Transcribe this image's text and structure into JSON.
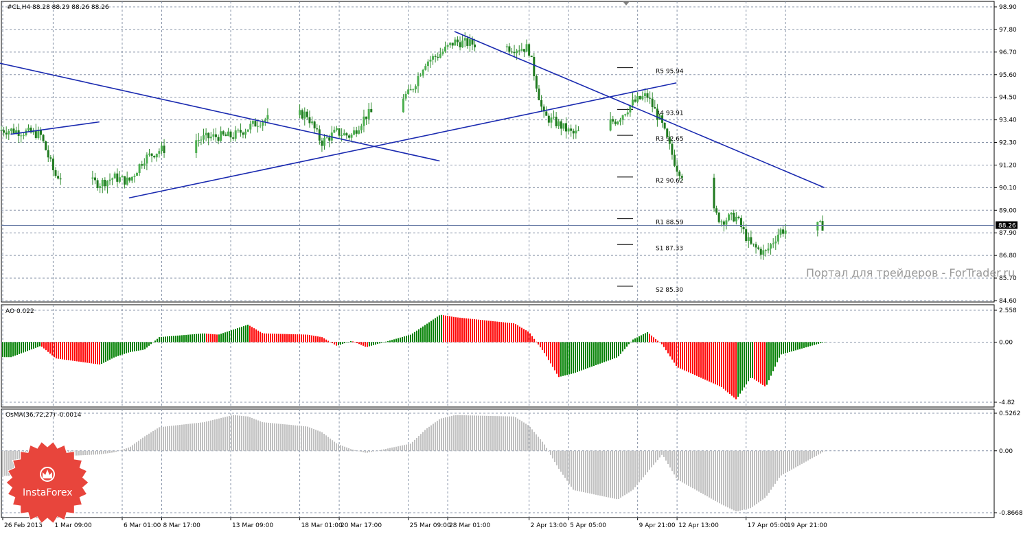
{
  "chart_data": [
    {
      "type": "candlestick",
      "title": "#CL,H4 88.28 88.29 88.26 88.26",
      "symbol": "#CL",
      "timeframe": "H4",
      "ohlc": {
        "open": 88.28,
        "high": 88.29,
        "low": 88.26,
        "close": 88.26
      },
      "ylim": [
        84.6,
        98.9
      ],
      "y_ticks": [
        "98.90",
        "97.80",
        "96.70",
        "95.60",
        "94.50",
        "93.40",
        "92.30",
        "91.20",
        "90.10",
        "89.00",
        "87.90",
        "86.80",
        "85.70",
        "84.60"
      ],
      "current_price_label": "88.26",
      "current_price": 88.26,
      "candle_colors": {
        "up": "#4caf50",
        "down": "#1f7a1f",
        "wick": "#2e8b2e"
      },
      "close_series": [
        {
          "date": "2013-02-26",
          "close": 92.9
        },
        {
          "date": "2013-02-28",
          "close": 92.7
        },
        {
          "date": "2013-03-01",
          "close": 90.7
        },
        {
          "date": "2013-03-04",
          "close": 90.3
        },
        {
          "date": "2013-03-05",
          "close": 90.6
        },
        {
          "date": "2013-03-06",
          "close": 90.4
        },
        {
          "date": "2013-03-07",
          "close": 91.5
        },
        {
          "date": "2013-03-08",
          "close": 91.9
        },
        {
          "date": "2013-03-11",
          "close": 92.5
        },
        {
          "date": "2013-03-12",
          "close": 92.6
        },
        {
          "date": "2013-03-13",
          "close": 92.6
        },
        {
          "date": "2013-03-14",
          "close": 93.0
        },
        {
          "date": "2013-03-15",
          "close": 93.4
        },
        {
          "date": "2013-03-18",
          "close": 93.7
        },
        {
          "date": "2013-03-19",
          "close": 92.3
        },
        {
          "date": "2013-03-20",
          "close": 92.8
        },
        {
          "date": "2013-03-21",
          "close": 92.6
        },
        {
          "date": "2013-03-22",
          "close": 93.6
        },
        {
          "date": "2013-03-25",
          "close": 94.7
        },
        {
          "date": "2013-03-26",
          "close": 96.2
        },
        {
          "date": "2013-03-27",
          "close": 96.6
        },
        {
          "date": "2013-03-28",
          "close": 97.2
        },
        {
          "date": "2013-04-01",
          "close": 96.9
        },
        {
          "date": "2013-04-02",
          "close": 96.9
        },
        {
          "date": "2013-04-03",
          "close": 93.6
        },
        {
          "date": "2013-04-04",
          "close": 93.2
        },
        {
          "date": "2013-04-05",
          "close": 92.7
        },
        {
          "date": "2013-04-08",
          "close": 93.4
        },
        {
          "date": "2013-04-09",
          "close": 94.2
        },
        {
          "date": "2013-04-10",
          "close": 94.6
        },
        {
          "date": "2013-04-11",
          "close": 93.2
        },
        {
          "date": "2013-04-12",
          "close": 91.1
        },
        {
          "date": "2013-04-15",
          "close": 88.5
        },
        {
          "date": "2013-04-16",
          "close": 88.7
        },
        {
          "date": "2013-04-17",
          "close": 87.3
        },
        {
          "date": "2013-04-18",
          "close": 86.9
        },
        {
          "date": "2013-04-19",
          "close": 88.0
        },
        {
          "date": "2013-04-22",
          "close": 88.26
        }
      ],
      "trend_lines": [
        {
          "from": {
            "date": "2013-02-25",
            "price": 96.2
          },
          "to": {
            "date": "2013-03-27",
            "price": 91.4
          }
        },
        {
          "from": {
            "date": "2013-02-26",
            "price": 92.7
          },
          "to": {
            "date": "2013-03-04",
            "price": 93.3
          }
        },
        {
          "from": {
            "date": "2013-03-06",
            "price": 89.6
          },
          "to": {
            "date": "2013-04-12",
            "price": 95.2
          }
        },
        {
          "from": {
            "date": "2013-03-28",
            "price": 97.7
          },
          "to": {
            "date": "2013-04-22",
            "price": 90.1
          }
        }
      ],
      "pivot_levels": [
        {
          "name": "R5",
          "value": 95.94,
          "label": "R5 95.94"
        },
        {
          "name": "R4",
          "value": 93.91,
          "label": "R4 93.91"
        },
        {
          "name": "R3",
          "value": 92.65,
          "label": "R3 92.65"
        },
        {
          "name": "R2",
          "value": 90.62,
          "label": "R2 90.62"
        },
        {
          "name": "R1",
          "value": 88.59,
          "label": "R1 88.59"
        },
        {
          "name": "S1",
          "value": 87.33,
          "label": "S1 87.33"
        },
        {
          "name": "S2",
          "value": 85.3,
          "label": "S2 85.30"
        }
      ],
      "x_ticks": [
        "26 Feb 2013",
        "1 Mar 09:00",
        "6 Mar 01:00",
        "8 Mar 17:00",
        "13 Mar 09:00",
        "18 Mar 01:00",
        "20 Mar 17:00",
        "25 Mar 09:00",
        "28 Mar 01:00",
        "2 Apr 13:00",
        "5 Apr 05:00",
        "9 Apr 21:00",
        "12 Apr 13:00",
        "17 Apr 05:00",
        "19 Apr 21:00"
      ],
      "watermark": "Портал для трейдеров - ForTrader.ru",
      "grid": true
    },
    {
      "type": "bar",
      "title": "AO 0.022",
      "indicator": "Awesome Oscillator",
      "ylim": [
        -4.82,
        2.558
      ],
      "y_ticks": [
        "2.558",
        "0.00",
        "-4.82"
      ],
      "colors": {
        "rising": "#008000",
        "falling": "#ff0000"
      },
      "x": [
        "2013-02-26",
        "2013-02-28",
        "2013-03-01",
        "2013-03-04",
        "2013-03-05",
        "2013-03-06",
        "2013-03-07",
        "2013-03-08",
        "2013-03-11",
        "2013-03-12",
        "2013-03-13",
        "2013-03-14",
        "2013-03-15",
        "2013-03-18",
        "2013-03-19",
        "2013-03-20",
        "2013-03-21",
        "2013-03-22",
        "2013-03-25",
        "2013-03-26",
        "2013-03-27",
        "2013-03-28",
        "2013-04-01",
        "2013-04-02",
        "2013-04-03",
        "2013-04-04",
        "2013-04-05",
        "2013-04-08",
        "2013-04-09",
        "2013-04-10",
        "2013-04-11",
        "2013-04-12",
        "2013-04-15",
        "2013-04-16",
        "2013-04-17",
        "2013-04-18",
        "2013-04-19",
        "2013-04-22"
      ],
      "values": [
        -1.2,
        -0.3,
        -1.3,
        -1.8,
        -1.2,
        -0.8,
        -0.6,
        0.4,
        0.7,
        0.6,
        1.0,
        1.4,
        0.7,
        0.6,
        0.4,
        -0.3,
        0.1,
        -0.4,
        0.6,
        1.4,
        2.2,
        2.0,
        1.5,
        0.8,
        -0.8,
        -2.8,
        -2.5,
        -1.2,
        0.2,
        0.8,
        -0.2,
        -2.0,
        -3.6,
        -4.6,
        -2.8,
        -3.6,
        -1.0,
        0.02
      ]
    },
    {
      "type": "bar",
      "title": "OsMA(36,72,27) -0.0014",
      "indicator": "OsMA",
      "ylim": [
        -0.8668,
        0.5262
      ],
      "y_ticks": [
        "0.5262",
        "0.00",
        "-0.8668"
      ],
      "colors": {
        "bars": "#c0c0c0"
      },
      "x": [
        "2013-02-26",
        "2013-02-28",
        "2013-03-01",
        "2013-03-04",
        "2013-03-05",
        "2013-03-06",
        "2013-03-07",
        "2013-03-08",
        "2013-03-11",
        "2013-03-12",
        "2013-03-13",
        "2013-03-14",
        "2013-03-15",
        "2013-03-18",
        "2013-03-19",
        "2013-03-20",
        "2013-03-21",
        "2013-03-22",
        "2013-03-25",
        "2013-03-26",
        "2013-03-27",
        "2013-03-28",
        "2013-04-01",
        "2013-04-02",
        "2013-04-03",
        "2013-04-04",
        "2013-04-05",
        "2013-04-08",
        "2013-04-09",
        "2013-04-10",
        "2013-04-11",
        "2013-04-12",
        "2013-04-15",
        "2013-04-16",
        "2013-04-17",
        "2013-04-18",
        "2013-04-19",
        "2013-04-22"
      ],
      "values": [
        -0.35,
        -0.2,
        -0.08,
        -0.05,
        -0.02,
        0.05,
        0.2,
        0.33,
        0.4,
        0.45,
        0.5,
        0.48,
        0.4,
        0.34,
        0.26,
        0.1,
        0.02,
        -0.03,
        0.1,
        0.3,
        0.45,
        0.5,
        0.48,
        0.35,
        0.1,
        -0.25,
        -0.55,
        -0.68,
        -0.55,
        -0.3,
        -0.05,
        -0.4,
        -0.75,
        -0.85,
        -0.8,
        -0.65,
        -0.35,
        -0.0014
      ]
    }
  ],
  "logo": {
    "text": "InstaForex",
    "color": "#e8453c"
  }
}
